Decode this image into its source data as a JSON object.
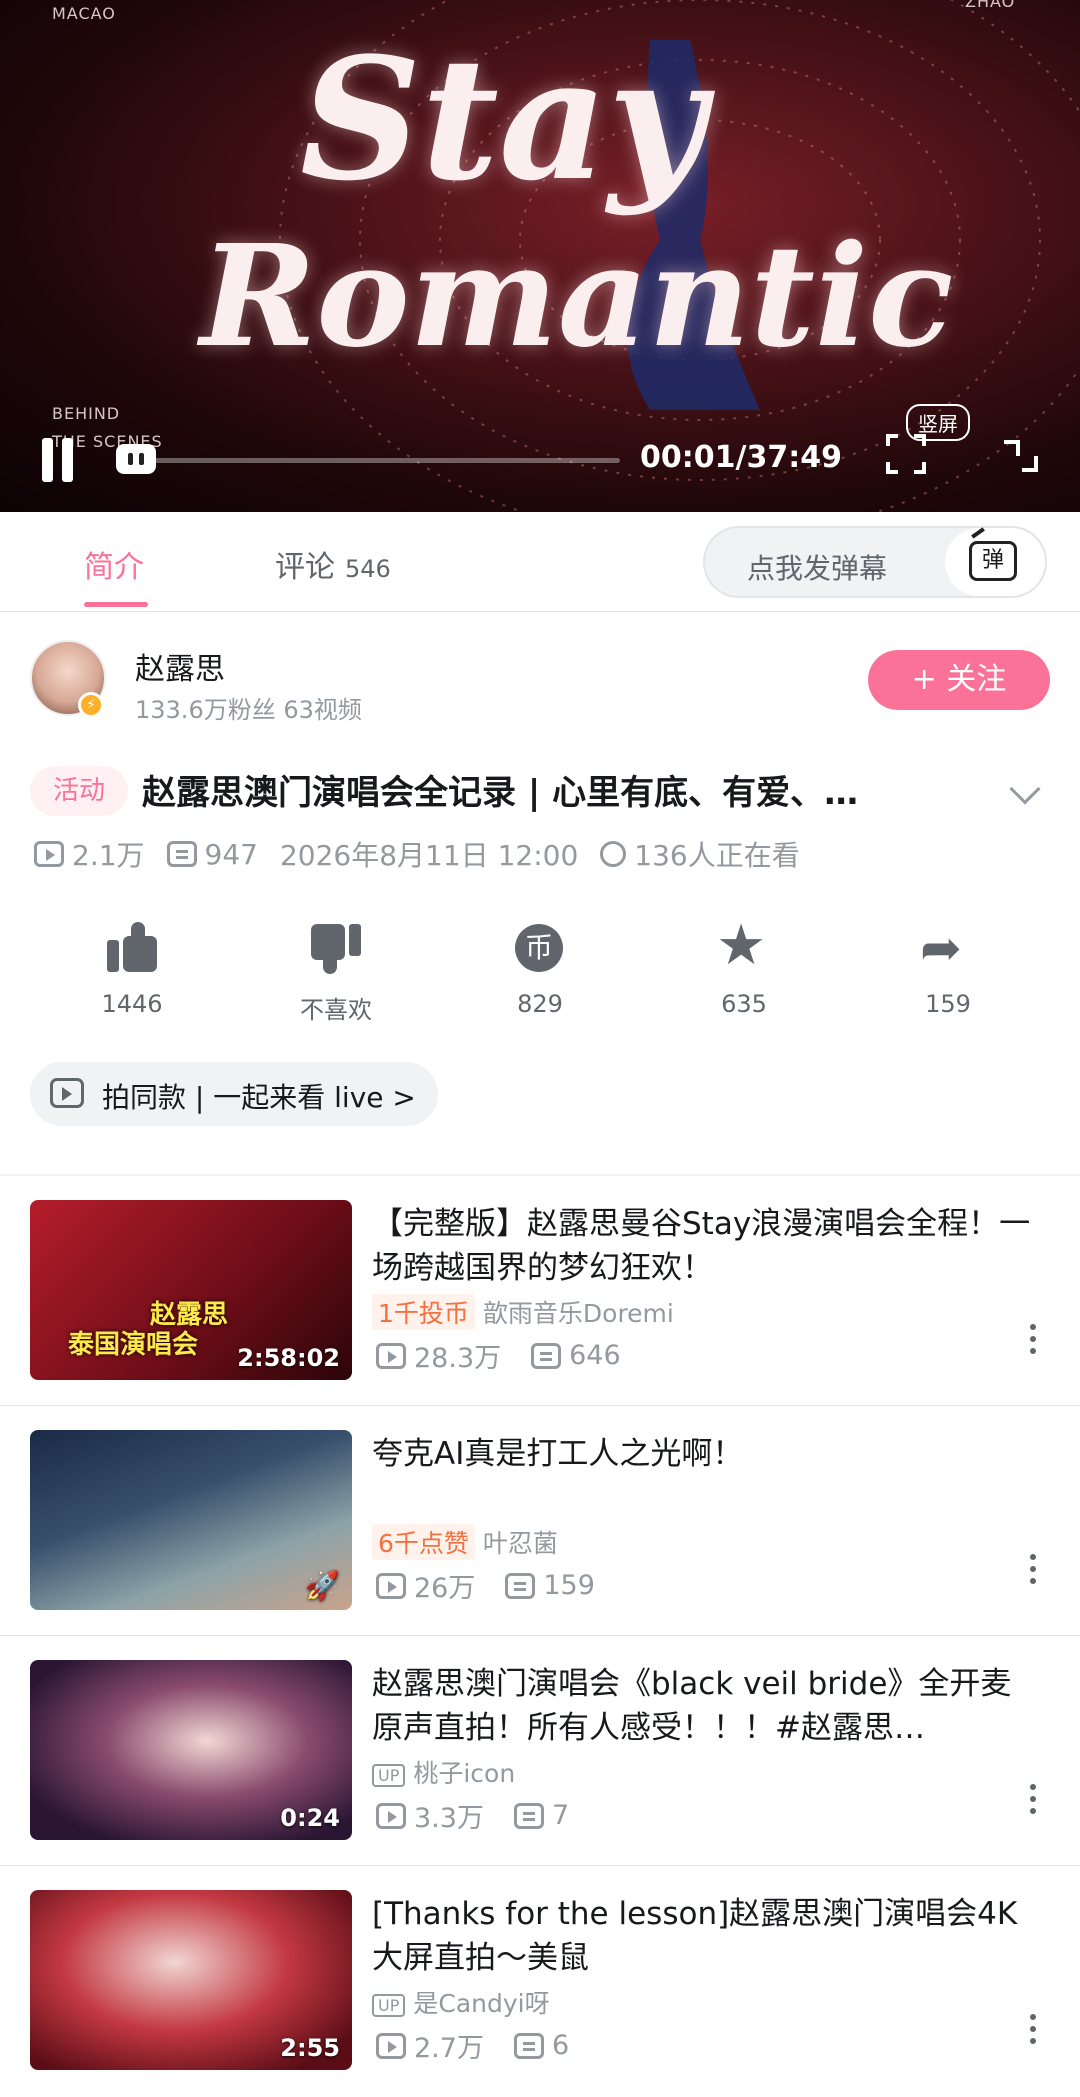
{
  "player": {
    "corner_left": "MACAO",
    "corner_right": "ZHAO",
    "art_line1": "Stay",
    "art_line2": "Romantic",
    "behind_line1": "BEHIND",
    "behind_line2": "THE SCENES",
    "time": "00:01/37:49",
    "progress": 0.0005,
    "vertical_label": "竖屏",
    "accent": "#fb7299"
  },
  "tabs": {
    "intro": "简介",
    "comments": "评论",
    "comments_count": "546",
    "danmaku_placeholder": "点我发弹幕",
    "danmaku_icon": "弹"
  },
  "uploader": {
    "name": "赵露思",
    "stats": "133.6万粉丝  63视频",
    "follow": "+ 关注"
  },
  "video": {
    "activity_badge": "活动",
    "title": "赵露思澳门演唱会全记录 | 心里有底、有爱、…",
    "views": "2.1万",
    "danmaku": "947",
    "date": "2026年8月11日 12:00",
    "watching": "136人正在看"
  },
  "actions": {
    "like": "1446",
    "dislike": "不喜欢",
    "coin": "829",
    "favorite": "635",
    "share": "159"
  },
  "pill": "拍同款 | 一起来看 live >",
  "recommendations": [
    {
      "title": "【完整版】赵露思曼谷Stay浪漫演唱会全程！一场跨越国界的梦幻狂欢！",
      "badge": "1千投币",
      "author": "歆雨音乐Doremi",
      "views": "28.3万",
      "danmaku": "646",
      "duration": "2:58:02",
      "caption1": "赵露思",
      "caption2": "泰国演唱会"
    },
    {
      "title": "夸克AI真是打工人之光啊！",
      "badge": "6千点赞",
      "author": "叶忍菌",
      "views": "26万",
      "danmaku": "159",
      "duration": ""
    },
    {
      "title": "赵露思澳门演唱会《black veil bride》全开麦原声直拍！所有人感受！！！#赵露思…",
      "badge": "",
      "author": "桃子icon",
      "views": "3.3万",
      "danmaku": "7",
      "duration": "0:24"
    },
    {
      "title": "[Thanks for the lesson]赵露思澳门演唱会4K大屏直拍～美鼠",
      "badge": "",
      "author": "是Candyi呀",
      "views": "2.7万",
      "danmaku": "6",
      "duration": "2:55"
    }
  ]
}
